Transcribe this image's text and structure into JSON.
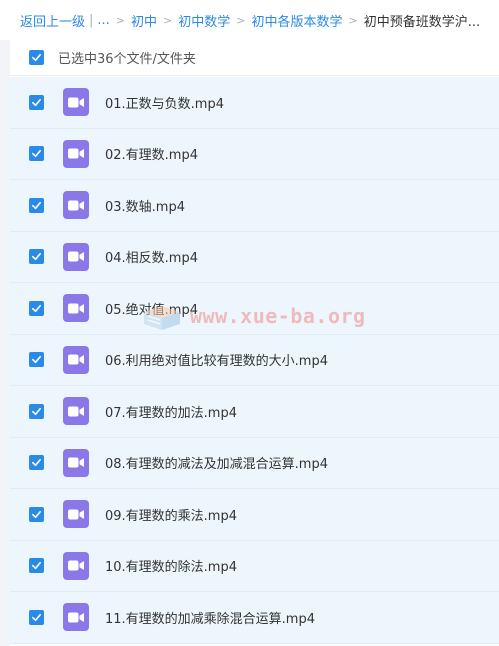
{
  "breadcrumb": {
    "back": "返回上一级",
    "ellipsis": "...",
    "items": [
      "初中",
      "初中数学",
      "初中各版本数学"
    ],
    "current": "初中预备班数学沪..."
  },
  "selection": {
    "label": "已选中36个文件/文件夹",
    "checked": true
  },
  "files": [
    {
      "name": "01.正数与负数.mp4",
      "checked": true,
      "icon": "video-file-icon"
    },
    {
      "name": "02.有理数.mp4",
      "checked": true,
      "icon": "video-file-icon"
    },
    {
      "name": "03.数轴.mp4",
      "checked": true,
      "icon": "video-file-icon"
    },
    {
      "name": "04.相反数.mp4",
      "checked": true,
      "icon": "video-file-icon"
    },
    {
      "name": "05.绝对值.mp4",
      "checked": true,
      "icon": "video-file-icon"
    },
    {
      "name": "06.利用绝对值比较有理数的大小.mp4",
      "checked": true,
      "icon": "video-file-icon"
    },
    {
      "name": "07.有理数的加法.mp4",
      "checked": true,
      "icon": "video-file-icon"
    },
    {
      "name": "08.有理数的减法及加减混合运算.mp4",
      "checked": true,
      "icon": "video-file-icon"
    },
    {
      "name": "09.有理数的乘法.mp4",
      "checked": true,
      "icon": "video-file-icon"
    },
    {
      "name": "10.有理数的除法.mp4",
      "checked": true,
      "icon": "video-file-icon"
    },
    {
      "name": "11.有理数的加减乘除混合运算.mp4",
      "checked": true,
      "icon": "video-file-icon"
    }
  ],
  "watermark": {
    "text": "www.xue-ba.org"
  },
  "colors": {
    "accent": "#2a8ae8",
    "row_bg": "#eef6fd",
    "video_icon": "#8a78e8",
    "watermark": "#f08a8a"
  }
}
